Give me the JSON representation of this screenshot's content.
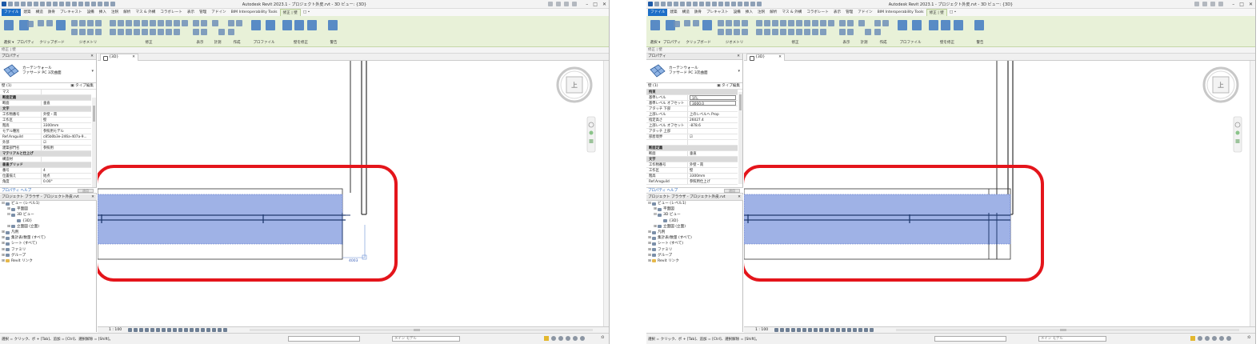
{
  "left_window": {
    "app_title": "Autodesk Revit 2023.1 - プロジェクト外皮.rvt - 3D ビュー: {3D}",
    "tabs": [
      "ファイル",
      "建築",
      "構造",
      "鉄骨",
      "プレキャスト",
      "設備",
      "挿入",
      "注釈",
      "解析",
      "マス & 外構",
      "コラボレート",
      "表示",
      "管理",
      "アドイン",
      "BIM Interoperability Tools",
      "修正 | 壁",
      "□ •"
    ],
    "ribbon_groups": [
      "選択 ▾",
      "プロパティ",
      "クリップボード",
      "ジオメトリ",
      "修正",
      "表示",
      "計測",
      "作成",
      "プロファイル",
      "壁を修正",
      "警告"
    ],
    "ribbon_buttons": {
      "modify": "修正",
      "edit_profile": "プロファイル編集",
      "attach": "アタッチ 上/下部",
      "detach": "デタッチ 上/下部",
      "warnings": "警告を表示"
    },
    "option_bar": "修正 | 壁",
    "properties": {
      "header": "プロパティ",
      "type_name_line1": "カーテンウォール",
      "type_name_line2": "ファサード PC 3次曲面",
      "filter": "壁 (1)",
      "edit_type": "タイプ編集",
      "rows": [
        {
          "k": "マス",
          "v": "",
          "cat": false
        },
        {
          "k": "断面定義",
          "v": "",
          "cat": true
        },
        {
          "k": "断面",
          "v": "垂直",
          "cat": false
        },
        {
          "k": "文字",
          "v": "",
          "cat": true
        },
        {
          "k": "工作物番号",
          "v": "外壁・南",
          "cat": false
        },
        {
          "k": "工作区",
          "v": "壁",
          "cat": false
        },
        {
          "k": "階高",
          "v": "3300mm",
          "cat": false
        },
        {
          "k": "モデル種別",
          "v": "参照用モデル",
          "cat": false
        },
        {
          "k": "Ref.Arxguild",
          "v": "c85b0b3e-246a-407a-9...",
          "cat": false
        },
        {
          "k": "外部",
          "v": "☑",
          "cat": false
        },
        {
          "k": "建築部門名",
          "v": "参照用",
          "cat": false
        },
        {
          "k": "マテリアルと仕上げ",
          "v": "",
          "cat": true
        },
        {
          "k": "構造材",
          "v": "",
          "cat": false
        },
        {
          "k": "垂直グリッド",
          "v": "",
          "cat": true
        },
        {
          "k": "番号",
          "v": "4",
          "cat": false
        },
        {
          "k": "位置揃え",
          "v": "始点",
          "cat": false
        },
        {
          "k": "角度",
          "v": "0.00°",
          "cat": false
        }
      ],
      "help_link": "プロパティ ヘルプ",
      "apply": "適用"
    },
    "project_browser": {
      "header": "プロジェクト ブラウザ - プロジェクト外皮.rvt",
      "nodes": [
        {
          "pm": "⊟",
          "label": "ビュー (レベル1)",
          "depth": 0,
          "revit": false
        },
        {
          "pm": "⊞",
          "label": "平面図",
          "depth": 1,
          "revit": false
        },
        {
          "pm": "⊟",
          "label": "3D ビュー",
          "depth": 1,
          "revit": false
        },
        {
          "pm": "",
          "label": "{3D}",
          "depth": 2,
          "revit": false
        },
        {
          "pm": "⊞",
          "label": "立面図 (立面)",
          "depth": 1,
          "revit": false
        },
        {
          "pm": "⊞",
          "label": "凡例",
          "depth": 0,
          "revit": false
        },
        {
          "pm": "⊞",
          "label": "集計表/数量 (すべて)",
          "depth": 0,
          "revit": false
        },
        {
          "pm": "⊞",
          "label": "シート (すべて)",
          "depth": 0,
          "revit": false
        },
        {
          "pm": "⊞",
          "label": "ファミリ",
          "depth": 0,
          "revit": false
        },
        {
          "pm": "⊞",
          "label": "グループ",
          "depth": 0,
          "revit": false
        },
        {
          "pm": "⊞",
          "label": "Revit リンク",
          "depth": 0,
          "revit": true
        }
      ]
    },
    "view_tab": "{3D}",
    "viewcube_label": "上",
    "dimension_text": "4003",
    "scale": "1 : 100",
    "status_text": "選択 = クリック、ボ + [Tab]、追加 = [Ctrl]、選択解除 = [Shift]。",
    "model_select": "メイン モデル",
    "filter_count": ":0"
  },
  "right_window": {
    "app_title": "Autodesk Revit 2023.1 - プロジェクト外皮.rvt - 3D ビュー: {3D}",
    "option_bar": "修正 | 壁",
    "properties": {
      "header": "プロパティ",
      "type_name_line1": "カーテンウォール",
      "type_name_line2": "ファサード PC 3次曲面",
      "filter": "壁 (1)",
      "edit_type": "タイプ編集",
      "rows": [
        {
          "k": "拘束",
          "v": "",
          "cat": true
        },
        {
          "k": "基準レベル",
          "v": "1FL",
          "cat": false,
          "box": true
        },
        {
          "k": "基準レベル オフセット",
          "v": "3000.0",
          "cat": false,
          "box": true
        },
        {
          "k": "アタッチ 下部",
          "v": "",
          "cat": false
        },
        {
          "k": "上部レベル",
          "v": "上のレベルへ Prop",
          "cat": false
        },
        {
          "k": "指定高さ",
          "v": "26027.4",
          "cat": false
        },
        {
          "k": "上部レベル オフセット",
          "v": "-878.6",
          "cat": false
        },
        {
          "k": "アタッチ 上部",
          "v": "",
          "cat": false
        },
        {
          "k": "部屋境界",
          "v": "☑",
          "cat": false
        },
        {
          "k": "",
          "v": "",
          "cat": false
        },
        {
          "k": "断面定義",
          "v": "",
          "cat": true
        },
        {
          "k": "断面",
          "v": "垂直",
          "cat": false
        },
        {
          "k": "文字",
          "v": "",
          "cat": true
        },
        {
          "k": "工作物番号",
          "v": "外壁・南",
          "cat": false
        },
        {
          "k": "工作区",
          "v": "壁",
          "cat": false
        },
        {
          "k": "階高",
          "v": "3300mm",
          "cat": false
        },
        {
          "k": "Ref.Arxguild",
          "v": "参照用仕上げ",
          "cat": false
        }
      ],
      "help_link": "プロパティ ヘルプ",
      "apply": "適用"
    },
    "project_browser": {
      "header": "プロジェクト ブラウザ - プロジェクト外皮.rvt",
      "nodes": [
        {
          "pm": "⊟",
          "label": "ビュー (レベル1)",
          "depth": 0,
          "revit": false
        },
        {
          "pm": "⊞",
          "label": "平面図",
          "depth": 1,
          "revit": false
        },
        {
          "pm": "⊟",
          "label": "3D ビュー",
          "depth": 1,
          "revit": false
        },
        {
          "pm": "",
          "label": "{3D}",
          "depth": 2,
          "revit": false
        },
        {
          "pm": "⊞",
          "label": "立面図 (立面)",
          "depth": 1,
          "revit": false
        },
        {
          "pm": "⊞",
          "label": "凡例",
          "depth": 0,
          "revit": false
        },
        {
          "pm": "⊞",
          "label": "集計表/数量 (すべて)",
          "depth": 0,
          "revit": false
        },
        {
          "pm": "⊞",
          "label": "シート (すべて)",
          "depth": 0,
          "revit": false
        },
        {
          "pm": "⊞",
          "label": "ファミリ",
          "depth": 0,
          "revit": false
        },
        {
          "pm": "⊞",
          "label": "グループ",
          "depth": 0,
          "revit": false
        },
        {
          "pm": "⊞",
          "label": "Revit リンク",
          "depth": 0,
          "revit": true
        }
      ]
    },
    "view_tab": "{3D}",
    "viewcube_label": "上",
    "scale": "1 : 100",
    "status_text": "選択 = クリック、ボ + [Tab]、追加 = [Ctrl]、選択解除 = [Shift]。",
    "model_select": "メイン モデル",
    "filter_count": ":0"
  },
  "colors": {
    "highlight_fill": "#9fb2e6",
    "highlight_red": "#e4151b",
    "ribbon_bg": "#e8f1d8",
    "file_tab": "#1d6ec7"
  }
}
